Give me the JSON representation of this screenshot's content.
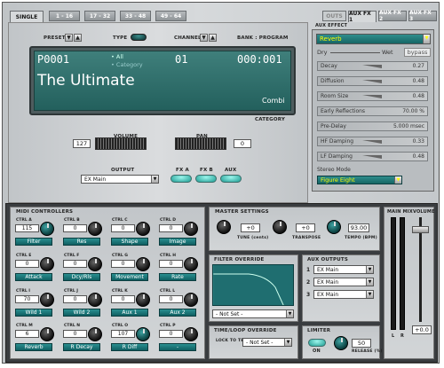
{
  "tabs": [
    "SINGLE",
    "1 - 16",
    "17 - 32",
    "33 - 48",
    "49 - 64"
  ],
  "aux_tabs": [
    "OUTS",
    "AUX FX 1",
    "AUX FX 2",
    "AUX FX 3"
  ],
  "aux_effect_label": "AUX EFFECT",
  "preset": {
    "label": "PRESET",
    "type_label": "TYPE",
    "channel_label": "CHANNEL",
    "bank_label": "BANK : PROGRAM"
  },
  "display": {
    "preset_id": "P0001",
    "filter1": "All",
    "filter2": "Category",
    "channel": "01",
    "bank": "000:001",
    "name": "The Ultimate",
    "type": "Combi",
    "category_label": "CATEGORY"
  },
  "volume": {
    "label": "VOLUME",
    "value": "127"
  },
  "pan": {
    "label": "PAN",
    "value": "0"
  },
  "output": {
    "label": "OUTPUT",
    "value": "EX Main"
  },
  "fx_buttons": [
    "FX A",
    "FX B",
    "AUX"
  ],
  "aux_fx": {
    "effect": "Reverb",
    "dry": "Dry",
    "wet": "Wet",
    "bypass": "bypass",
    "params": [
      {
        "name": "Decay",
        "value": "0.27"
      },
      {
        "name": "Diffusion",
        "value": "0.48"
      },
      {
        "name": "Room Size",
        "value": "0.48"
      },
      {
        "name": "Early Reflections",
        "value": "70.00 %"
      },
      {
        "name": "Pre-Delay",
        "value": "5.000 msec"
      },
      {
        "name": "HF Damping",
        "value": "0.33"
      },
      {
        "name": "LF Damping",
        "value": "0.48"
      }
    ],
    "stereo_mode_label": "Stereo Mode",
    "stereo_mode_value": "Figure Eight"
  },
  "midi": {
    "title": "MIDI CONTROLLERS",
    "controllers": [
      {
        "ctrl": "CTRL A",
        "value": "115",
        "label": "Filter"
      },
      {
        "ctrl": "CTRL B",
        "value": "0",
        "label": "Res"
      },
      {
        "ctrl": "CTRL C",
        "value": "0",
        "label": "Shape"
      },
      {
        "ctrl": "CTRL D",
        "value": "0",
        "label": "Image"
      },
      {
        "ctrl": "CTRL E",
        "value": "0",
        "label": "Attack"
      },
      {
        "ctrl": "CTRL F",
        "value": "0",
        "label": "Dcy/Rls"
      },
      {
        "ctrl": "CTRL G",
        "value": "0",
        "label": "Movement"
      },
      {
        "ctrl": "CTRL H",
        "value": "0",
        "label": "Rate"
      },
      {
        "ctrl": "CTRL I",
        "value": "70",
        "label": "Wild 1"
      },
      {
        "ctrl": "CTRL J",
        "value": "0",
        "label": "Wild 2"
      },
      {
        "ctrl": "CTRL K",
        "value": "0",
        "label": "Aux 1"
      },
      {
        "ctrl": "CTRL L",
        "value": "0",
        "label": "Aux 2"
      },
      {
        "ctrl": "CTRL M",
        "value": "6",
        "label": "Reverb"
      },
      {
        "ctrl": "CTRL N",
        "value": "0",
        "label": "R Decay"
      },
      {
        "ctrl": "CTRL O",
        "value": "107",
        "label": "R Diff"
      },
      {
        "ctrl": "CTRL P",
        "value": "0",
        "label": "-"
      }
    ]
  },
  "master": {
    "title": "MASTER SETTINGS",
    "tune_value": "+0",
    "tune_label": "TUNE (cents)",
    "transpose_value": "+0",
    "transpose_label": "TRANSPOSE",
    "tempo_value": "93.00",
    "tempo_label": "TEMPO (BPM)"
  },
  "filter_override": {
    "title": "FILTER OVERRIDE",
    "value": "- Not Set -"
  },
  "timestamp": {
    "title": "TIME/LOOP OVERRIDE",
    "lock_label": "LOCK TO TEMPO",
    "value": "- Not Set -"
  },
  "aux_outputs": {
    "title": "AUX OUTPUTS",
    "rows": [
      {
        "n": "1",
        "v": "EX Main"
      },
      {
        "n": "2",
        "v": "EX Main"
      },
      {
        "n": "3",
        "v": "EX Main"
      }
    ]
  },
  "limiter": {
    "title": "LIMITER",
    "on": "ON",
    "release_value": "50",
    "release_label": "RELEASE (%)"
  },
  "mix": {
    "main_mix": "MAIN MIX",
    "volume": "VOLUME",
    "l": "L",
    "r": "R",
    "value": "+0.0"
  }
}
